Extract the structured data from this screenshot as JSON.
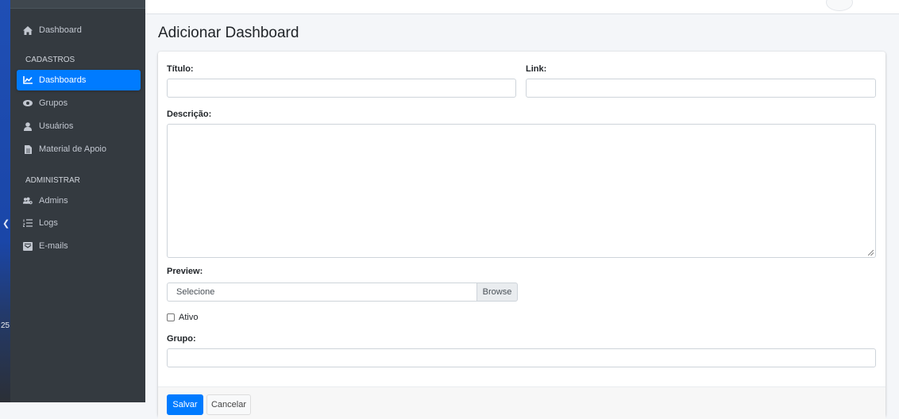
{
  "sidebar": {
    "items": [
      {
        "label": "Dashboard",
        "icon": "home-icon"
      },
      {
        "label": "Dashboards",
        "icon": "chart-line-icon",
        "active": true
      },
      {
        "label": "Grupos",
        "icon": "eye-icon"
      },
      {
        "label": "Usuários",
        "icon": "user-icon"
      },
      {
        "label": "Material de Apoio",
        "icon": "file-icon"
      },
      {
        "label": "Admins",
        "icon": "users-cog-icon"
      },
      {
        "label": "Logs",
        "icon": "list-ol-icon"
      },
      {
        "label": "E-mails",
        "icon": "mail-bulk-icon"
      }
    ],
    "headers": [
      "CADASTROS",
      "ADMINISTRAR"
    ]
  },
  "desktop": {
    "number": "25"
  },
  "page": {
    "title": "Adicionar Dashboard"
  },
  "form": {
    "titulo_label": "Título:",
    "titulo_value": "",
    "link_label": "Link:",
    "link_value": "",
    "descricao_label": "Descrição:",
    "descricao_value": "",
    "preview_label": "Preview:",
    "preview_placeholder": "Selecione",
    "browse_label": "Browse",
    "ativo_label": "Ativo",
    "ativo_checked": false,
    "grupo_label": "Grupo:",
    "grupo_value": ""
  },
  "footer": {
    "save_label": "Salvar",
    "cancel_label": "Cancelar"
  },
  "colors": {
    "accent": "#007bff",
    "sidebar_bg": "#343a40"
  }
}
